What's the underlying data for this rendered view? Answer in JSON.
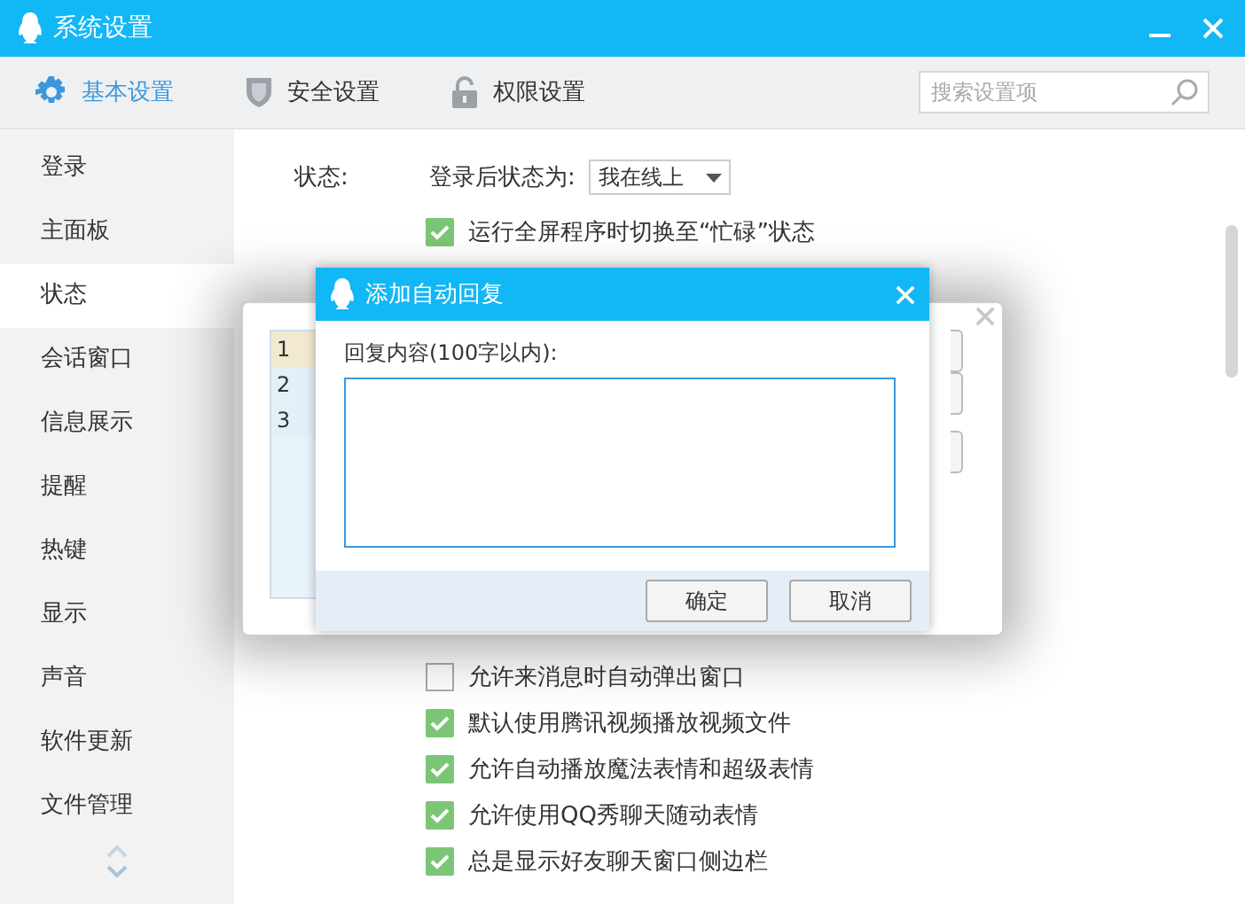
{
  "window": {
    "title": "系统设置"
  },
  "tabs": [
    {
      "label": "基本设置",
      "selected": true
    },
    {
      "label": "安全设置",
      "selected": false
    },
    {
      "label": "权限设置",
      "selected": false
    }
  ],
  "search": {
    "placeholder": "搜索设置项"
  },
  "sidebar": {
    "items": [
      {
        "label": "登录",
        "selected": false
      },
      {
        "label": "主面板",
        "selected": false
      },
      {
        "label": "状态",
        "selected": true
      },
      {
        "label": "会话窗口",
        "selected": false
      },
      {
        "label": "信息展示",
        "selected": false
      },
      {
        "label": "提醒",
        "selected": false
      },
      {
        "label": "热键",
        "selected": false
      },
      {
        "label": "显示",
        "selected": false
      },
      {
        "label": "声音",
        "selected": false
      },
      {
        "label": "软件更新",
        "selected": false
      },
      {
        "label": "文件管理",
        "selected": false
      }
    ]
  },
  "content": {
    "section_label": "状态:",
    "status_prompt": "登录后状态为:",
    "status_value": "我在线上",
    "top_options": [
      {
        "label": "运行全屏程序时切换至“忙碌”状态",
        "checked": true
      }
    ],
    "options": [
      {
        "label": "允许来消息时自动弹出窗口",
        "checked": false
      },
      {
        "label": "默认使用腾讯视频播放视频文件",
        "checked": true
      },
      {
        "label": "允许自动播放魔法表情和超级表情",
        "checked": true
      },
      {
        "label": "允许使用QQ秀聊天随动表情",
        "checked": true
      },
      {
        "label": "总是显示好友聊天窗口侧边栏",
        "checked": true
      }
    ]
  },
  "reply_list": {
    "rows": [
      {
        "label": "1",
        "selected": true
      },
      {
        "label": "2",
        "selected": false
      },
      {
        "label": "3",
        "selected": false
      }
    ]
  },
  "dialog": {
    "title": "添加自动回复",
    "field_label": "回复内容(100字以内):",
    "buttons": [
      "确定",
      "取消"
    ]
  }
}
